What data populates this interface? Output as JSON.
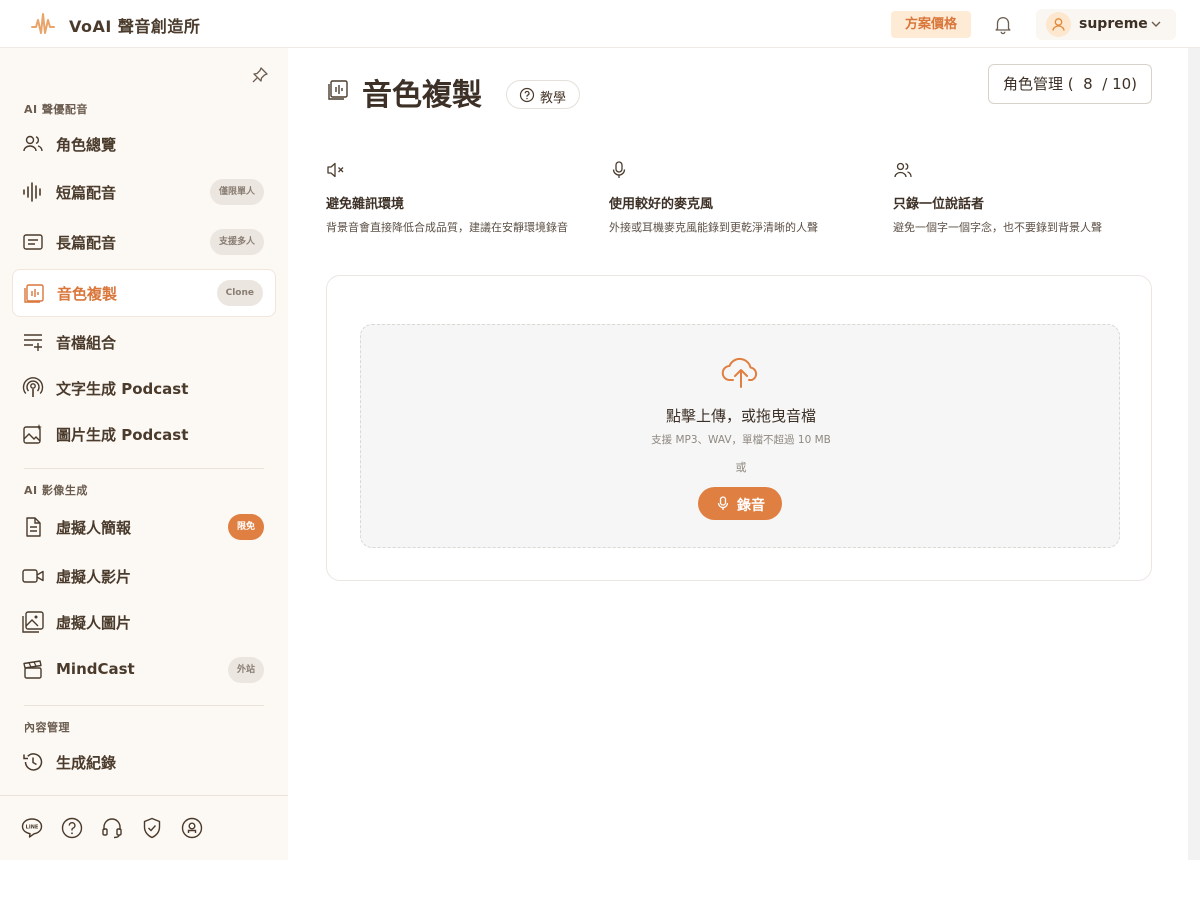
{
  "header": {
    "brand": "VoAI 聲音創造所",
    "pricing_label": "方案價格",
    "username": "supreme",
    "icons": {
      "logo": "voai-logo-icon",
      "bell": "bell-icon",
      "user": "user-icon",
      "chevron": "chevron-down-icon"
    }
  },
  "sidebar": {
    "sections": [
      {
        "label": "AI 聲優配音"
      },
      {
        "label": "AI 影像生成"
      },
      {
        "label": "內容管理"
      }
    ],
    "items": [
      {
        "label": "角色總覽",
        "icon": "users-icon"
      },
      {
        "label": "短篇配音",
        "icon": "waveform-icon",
        "badge": "僅限單人"
      },
      {
        "label": "長篇配音",
        "icon": "text-lines-icon",
        "badge": "支援多人"
      },
      {
        "label": "音色複製",
        "icon": "voice-clone-icon",
        "badge": "Clone",
        "active": true
      },
      {
        "label": "音檔組合",
        "icon": "audio-merge-icon"
      },
      {
        "label": "文字生成 Podcast",
        "icon": "podcast-icon"
      },
      {
        "label": "圖片生成 Podcast",
        "icon": "image-sparkle-icon"
      },
      {
        "label": "虛擬人簡報",
        "icon": "document-icon",
        "badge": "限免"
      },
      {
        "label": "虛擬人影片",
        "icon": "video-icon"
      },
      {
        "label": "虛擬人圖片",
        "icon": "image-icon"
      },
      {
        "label": "MindCast",
        "icon": "clapperboard-icon",
        "badge": "外站"
      },
      {
        "label": "生成紀錄",
        "icon": "history-icon"
      }
    ],
    "footer_icons": [
      "line-icon",
      "help-circle-icon",
      "headset-icon",
      "shield-check-icon",
      "account-circle-icon"
    ]
  },
  "main": {
    "title": "音色複製",
    "tutorial_label": "教學",
    "role_management": {
      "label": "角色管理",
      "used": "8",
      "total": "10"
    },
    "tips": [
      {
        "icon": "volume-mute-icon",
        "title": "避免雜訊環境",
        "desc": "背景音會直接降低合成品質，建議在安靜環境錄音"
      },
      {
        "icon": "microphone-icon",
        "title": "使用較好的麥克風",
        "desc": "外接或耳機麥克風能錄到更乾淨清晰的人聲"
      },
      {
        "icon": "users-icon",
        "title": "只錄一位說話者",
        "desc": "避免一個字一個字念，也不要錄到背景人聲"
      }
    ],
    "upload": {
      "icon": "cloud-upload-icon",
      "main_text": "點擊上傳，或拖曳音檔",
      "sub_text": "支援 MP3、WAV，單檔不超過 10 MB",
      "or_text": "或",
      "record_label": "錄音"
    }
  },
  "colors": {
    "accent": "#e07f42",
    "accent_text": "#d9763a",
    "sidebar_bg": "#fcf8f3",
    "text": "#3d3026"
  }
}
